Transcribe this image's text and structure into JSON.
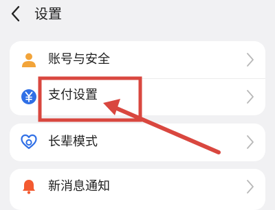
{
  "header": {
    "back_icon": "chevron-left-icon",
    "title": "设置"
  },
  "groups": [
    {
      "items": [
        {
          "label": "账号与安全",
          "icon": "user-icon",
          "icon_color": "#f2a43a"
        },
        {
          "label": "支付设置",
          "icon": "yuan-icon",
          "icon_color": "#2f6fe6"
        }
      ]
    },
    {
      "items": [
        {
          "label": "长辈模式",
          "icon": "heart-icon",
          "icon_color": "#2f6fe6"
        }
      ]
    },
    {
      "items": [
        {
          "label": "新消息通知",
          "icon": "bell-icon",
          "icon_color": "#f35a30"
        }
      ]
    }
  ],
  "colors": {
    "background": "#f1f1f3",
    "card": "#ffffff",
    "chevron": "#b8b8b8",
    "highlight": "#d9473f"
  }
}
